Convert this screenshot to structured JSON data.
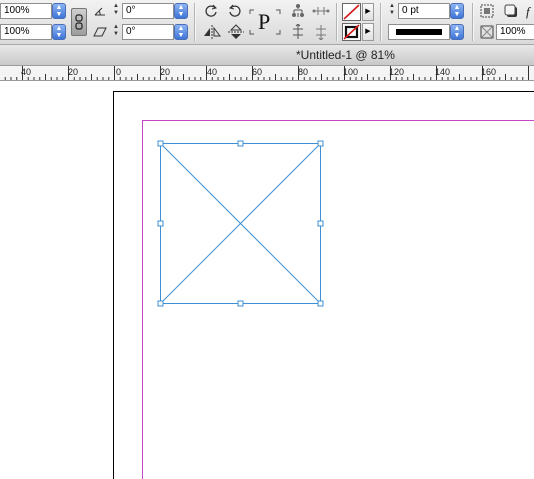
{
  "control_panel": {
    "scale_x_value": "100%",
    "scale_y_value": "100%",
    "rotation_value": "0°",
    "shear_value": "0°",
    "stroke_weight_value": "0 pt",
    "percent_value": "100%",
    "fill_color": "none",
    "stroke_color": "#000000",
    "icons": [
      "constrain-proportions-icon",
      "rotate-angle-icon",
      "shear-angle-icon",
      "rotate-90-cw-icon",
      "rotate-90-ccw-icon",
      "flip-horizontal-icon",
      "flip-vertical-icon",
      "reference-p-icon",
      "select-container-icon",
      "select-content-icon",
      "fill-swatch-icon",
      "stroke-swatch-icon",
      "stroke-type-icon",
      "text-wrap-icon",
      "drop-shadow-icon",
      "effects-icon",
      "opacity-icon"
    ],
    "reference_glyph": "P"
  },
  "document": {
    "title": "*Untitled-1 @ 81%",
    "zoom": "81%"
  },
  "ruler": {
    "labels": [
      "40",
      "20",
      "0",
      "20",
      "40",
      "60",
      "80",
      "100",
      "120",
      "140",
      "160"
    ]
  },
  "colors": {
    "margin_guide": "#c646c6",
    "selection": "#3d8fd6",
    "page_edge": "#000000"
  }
}
